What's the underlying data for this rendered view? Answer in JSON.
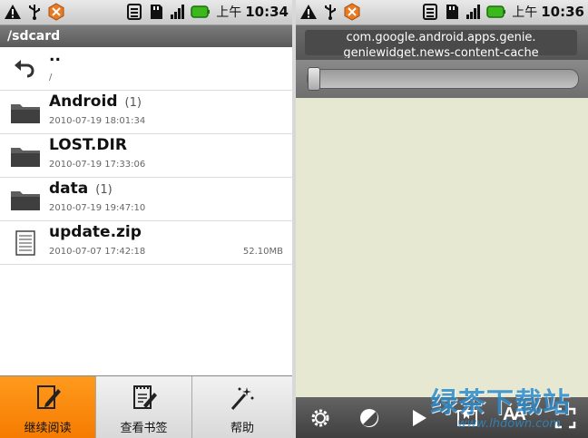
{
  "status_bar": {
    "am_label": "上午",
    "time_left": "10:34",
    "time_right": "10:36"
  },
  "left": {
    "path": "/sdcard",
    "files": [
      {
        "name": "..",
        "subtitle": "/",
        "count": "",
        "date": "",
        "size": "",
        "icon": "back-arrow-icon"
      },
      {
        "name": "Android",
        "count": "(1)",
        "date": "2010-07-19 18:01:34",
        "size": "",
        "icon": "folder-icon"
      },
      {
        "name": "LOST.DIR",
        "count": "",
        "date": "2010-07-19 17:33:06",
        "size": "",
        "icon": "folder-icon"
      },
      {
        "name": "data",
        "count": "(1)",
        "date": "2010-07-19 19:47:10",
        "size": "",
        "icon": "folder-icon"
      },
      {
        "name": "update.zip",
        "count": "",
        "date": "2010-07-07 17:42:18",
        "size": "52.10MB",
        "icon": "file-icon"
      }
    ],
    "bottom_buttons": [
      {
        "label": "继续阅读",
        "icon": "edit-document-icon",
        "active": true
      },
      {
        "label": "查看书签",
        "icon": "bookmark-list-icon",
        "active": false
      },
      {
        "label": "帮助",
        "icon": "magic-wand-icon",
        "active": false
      }
    ]
  },
  "right": {
    "title_line1": "com.google.android.apps.genie.",
    "title_line2": "geniewidget.news-content-cache",
    "progress": 0,
    "toolbar": [
      "settings-icon",
      "contrast-icon",
      "play-icon",
      "bookmark-icon",
      "font-size-icon",
      "fullscreen-icon"
    ],
    "font_size_label": "AA"
  },
  "watermark": {
    "main": "绿茶下载站",
    "url": "www.lhdown.com"
  },
  "colors": {
    "accent_orange": "#f57b00",
    "reader_bg": "#e6e8d2",
    "battery_green": "#3cb81e"
  }
}
